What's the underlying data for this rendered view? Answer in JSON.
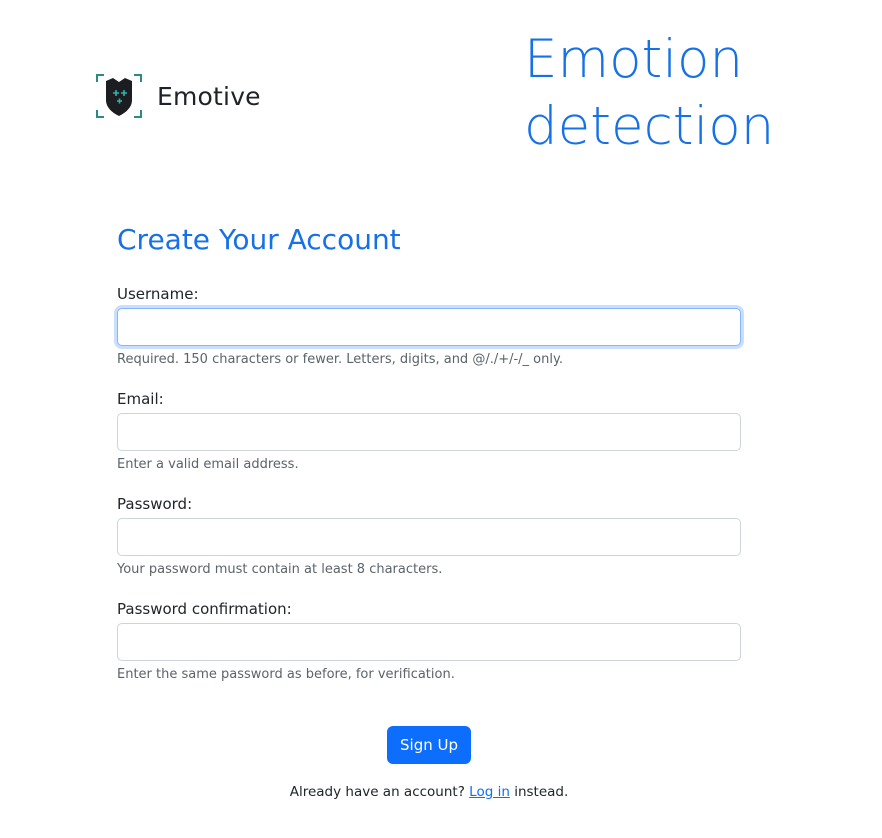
{
  "brand": {
    "name": "Emotive",
    "logo_icon": "shield-sparkle-logo"
  },
  "hero": {
    "title_line1": "Emotion",
    "title_line2": "detection"
  },
  "form": {
    "title": "Create Your Account",
    "fields": [
      {
        "label": "Username:",
        "value": "",
        "help": "Required. 150 characters or fewer. Letters, digits, and @/./+/-/_ only."
      },
      {
        "label": "Email:",
        "value": "",
        "help": "Enter a valid email address."
      },
      {
        "label": "Password:",
        "value": "",
        "help": "Your password must contain at least 8 characters."
      },
      {
        "label": "Password confirmation:",
        "value": "",
        "help": "Enter the same password as before, for verification."
      }
    ],
    "submit_label": "Sign Up",
    "login_prefix": "Already have an account?",
    "login_link": "Log in",
    "login_suffix": "instead."
  },
  "colors": {
    "accent": "#1670e6",
    "button": "#0d6efd",
    "focus_ring": "#86b7fe"
  }
}
